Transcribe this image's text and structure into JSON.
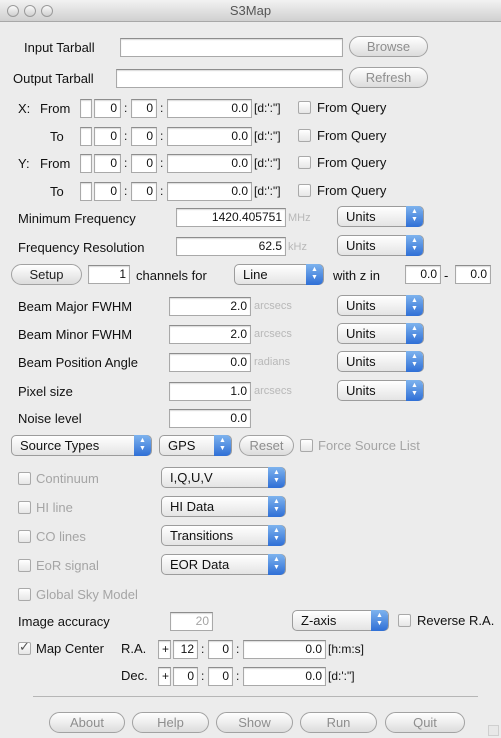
{
  "window": {
    "title": "S3Map"
  },
  "input_tarball": {
    "label": "Input Tarball",
    "value": "",
    "browse": "Browse"
  },
  "output_tarball": {
    "label": "Output Tarball",
    "value": "",
    "refresh": "Refresh"
  },
  "coords": {
    "x_label": "X:",
    "y_label": "Y:",
    "from": "From",
    "to": "To",
    "unit": "[d:':\"]",
    "from_query": "From Query",
    "rows": [
      {
        "sign": "",
        "deg": "0",
        "min": "0",
        "sec": "0.0"
      },
      {
        "sign": "",
        "deg": "0",
        "min": "0",
        "sec": "0.0"
      },
      {
        "sign": "",
        "deg": "0",
        "min": "0",
        "sec": "0.0"
      },
      {
        "sign": "",
        "deg": "0",
        "min": "0",
        "sec": "0.0"
      }
    ]
  },
  "freq": {
    "min_label": "Minimum Frequency",
    "min_value": "1420.405751",
    "min_unit": "MHz",
    "res_label": "Frequency Resolution",
    "res_value": "62.5",
    "res_unit": "kHz",
    "units": "Units"
  },
  "setup": {
    "button": "Setup",
    "channels": "1",
    "channels_for": "channels for",
    "mode": "Line",
    "with_z_in": "with z in",
    "z_min": "0.0",
    "dash": "-",
    "z_max": "0.0"
  },
  "beam": {
    "major_label": "Beam Major FWHM",
    "major_value": "2.0",
    "major_unit": "arcsecs",
    "minor_label": "Beam Minor FWHM",
    "minor_value": "2.0",
    "minor_unit": "arcsecs",
    "pa_label": "Beam Position Angle",
    "pa_value": "0.0",
    "pa_unit": "radians",
    "pixel_label": "Pixel size",
    "pixel_value": "1.0",
    "pixel_unit": "arcsecs",
    "noise_label": "Noise level",
    "noise_value": "0.0",
    "units": "Units"
  },
  "sources": {
    "type": "Source Types",
    "gps": "GPS",
    "reset": "Reset",
    "force": "Force Source List"
  },
  "components": [
    {
      "label": "Continuum",
      "option": "I,Q,U,V"
    },
    {
      "label": "HI line",
      "option": "HI Data"
    },
    {
      "label": "CO lines",
      "option": "Transitions"
    },
    {
      "label": "EoR signal",
      "option": "EOR Data"
    }
  ],
  "global_sky": "Global Sky Model",
  "accuracy": {
    "label": "Image accuracy",
    "value": "20",
    "axis": "Z-axis",
    "reverse": "Reverse R.A."
  },
  "map_center": {
    "label": "Map Center",
    "ra_label": "R.A.",
    "ra_sign": "+",
    "ra_h": "12",
    "ra_m": "0",
    "ra_s": "0.0",
    "ra_unit": "[h:m:s]",
    "dec_label": "Dec.",
    "dec_sign": "+",
    "dec_d": "0",
    "dec_m": "0",
    "dec_s": "0.0",
    "dec_unit": "[d:':\"]",
    "colon": ":"
  },
  "buttons": {
    "about": "About",
    "help": "Help",
    "show": "Show",
    "run": "Run",
    "quit": "Quit"
  }
}
